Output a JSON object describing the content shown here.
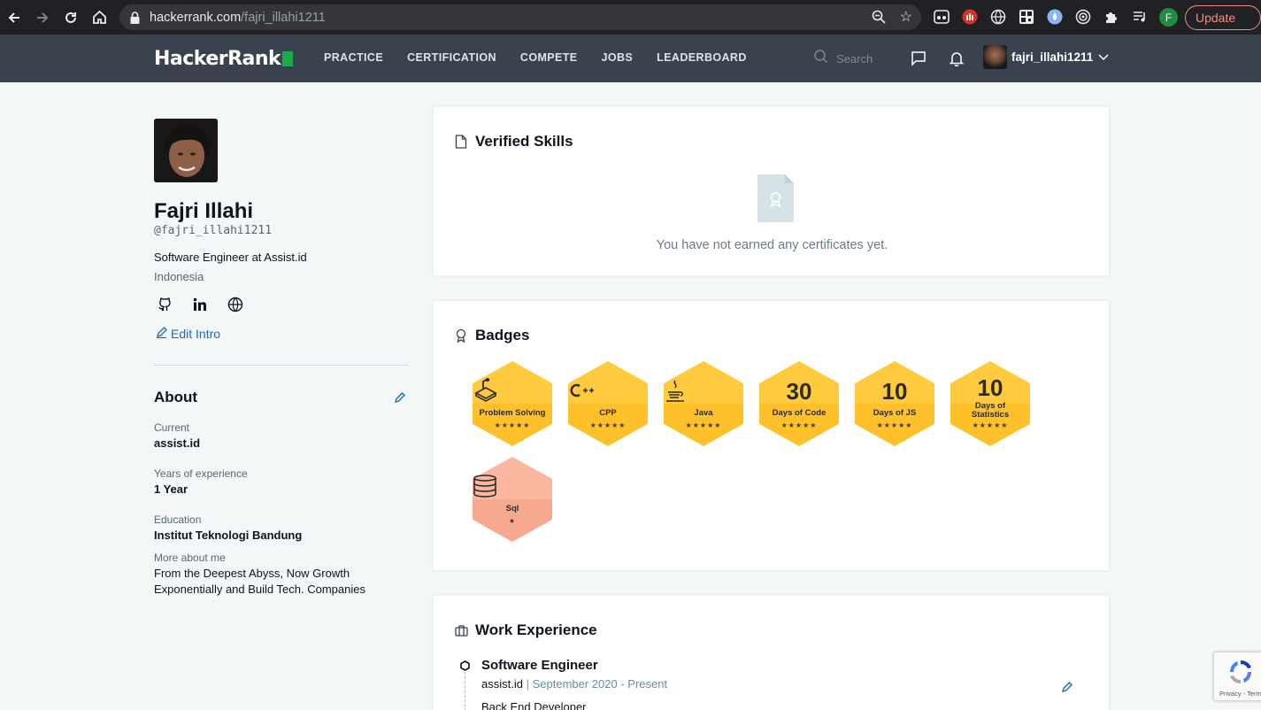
{
  "browser": {
    "url_host": "hackerrank.com",
    "url_path": "/fajri_illahi1211",
    "profile_initial": "F",
    "update_label": "Update"
  },
  "header": {
    "logo": "HackerRank",
    "nav": [
      "PRACTICE",
      "CERTIFICATION",
      "COMPETE",
      "JOBS",
      "LEADERBOARD"
    ],
    "search_placeholder": "Search",
    "username": "fajri_illahi1211"
  },
  "profile": {
    "name": "Fajri Illahi",
    "handle": "@fajri_illahi1211",
    "role": "Software Engineer at Assist.id",
    "country": "Indonesia",
    "edit_intro": "Edit Intro"
  },
  "about": {
    "title": "About",
    "fields": [
      {
        "label": "Current",
        "value": "assist.id"
      },
      {
        "label": "Years of experience",
        "value": "1 Year"
      },
      {
        "label": "Education",
        "value": "Institut Teknologi Bandung"
      },
      {
        "label": "More about me",
        "value": "From the Deepest Abyss, Now Growth Exponentially and Build Tech. Companies"
      }
    ]
  },
  "verified_skills": {
    "title": "Verified Skills",
    "empty_text": "You have not earned any certificates yet."
  },
  "badges": {
    "title": "Badges",
    "items": [
      {
        "label": "Problem Solving",
        "stars": "★★★★★",
        "color": "#ffc12a"
      },
      {
        "label": "CPP",
        "stars": "★★★★★",
        "color": "#ffc12a"
      },
      {
        "label": "Java",
        "stars": "★★★★★",
        "color": "#ffc12a"
      },
      {
        "number": "30",
        "label": "Days of Code",
        "stars": "★★★★★",
        "color": "#ffc12a"
      },
      {
        "number": "10",
        "label": "Days of JS",
        "stars": "★★★★★",
        "color": "#ffc12a"
      },
      {
        "number": "10",
        "label": "Days of Statistics",
        "stars": "★★★★★",
        "color": "#ffc12a"
      },
      {
        "label": "Sql",
        "stars": "★",
        "color": "#f7a98f"
      }
    ]
  },
  "work": {
    "title": "Work Experience",
    "jobs": [
      {
        "title": "Software Engineer",
        "company": "assist.id",
        "separator": "|",
        "dates": "September 2020 - Present",
        "description": "Back End Developer"
      }
    ]
  },
  "recaptcha": {
    "terms": "Privacy - Terms"
  }
}
